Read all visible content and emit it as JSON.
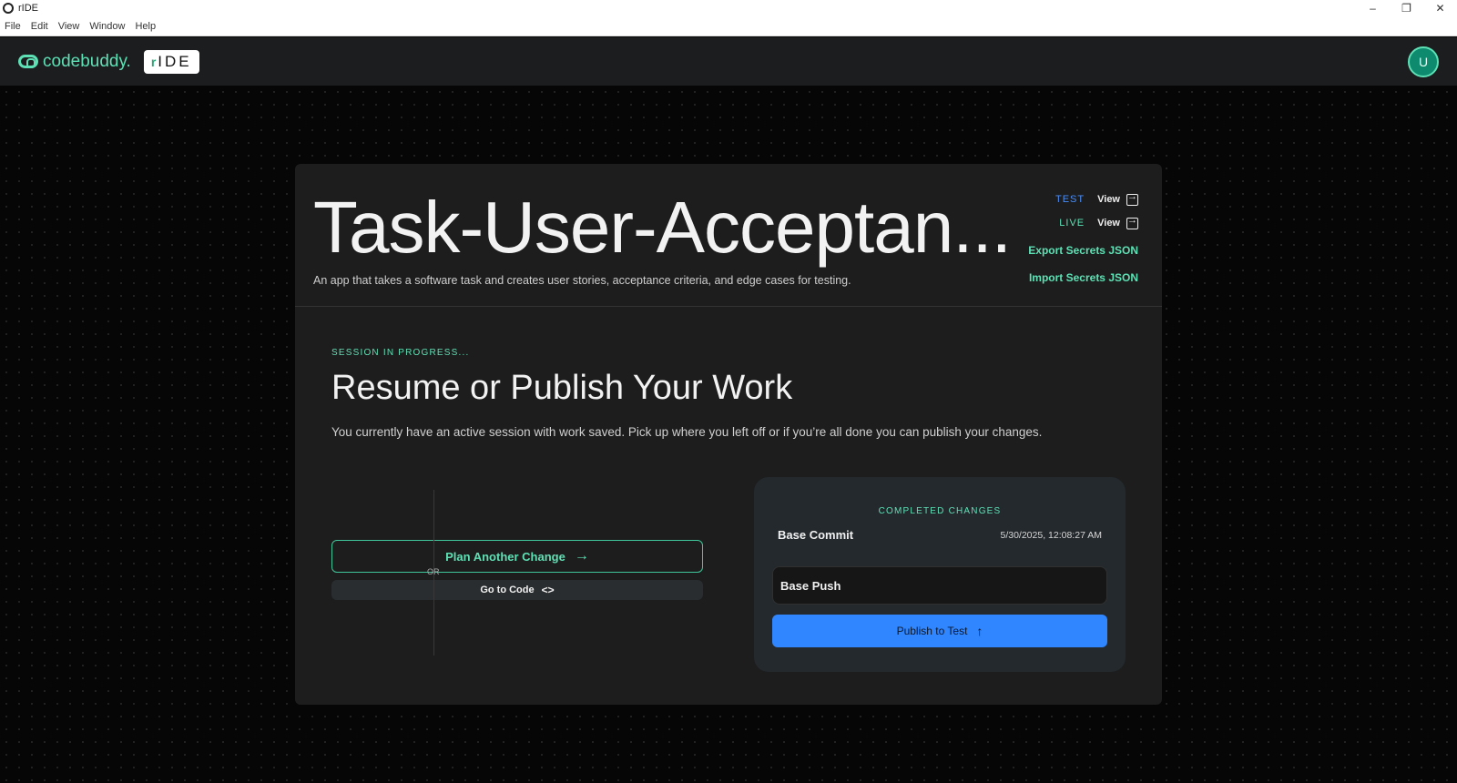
{
  "window": {
    "title": "rIDE",
    "minimize": "–",
    "restore": "❐",
    "close": "✕"
  },
  "menu": [
    "File",
    "Edit",
    "View",
    "Window",
    "Help"
  ],
  "header": {
    "brand": "codebuddy.",
    "badge_r": "r",
    "badge": "IDE",
    "avatar_initial": "U"
  },
  "app": {
    "title": "Task-User-Acceptan...",
    "description": "An app that takes a software task and creates user stories, acceptance criteria, and edge cases for testing."
  },
  "environments": [
    {
      "label": "TEST",
      "action": "View"
    },
    {
      "label": "LIVE",
      "action": "View"
    }
  ],
  "secrets": {
    "export_label": "Export Secrets JSON",
    "import_label": "Import Secrets JSON"
  },
  "session": {
    "status": "SESSION IN PROGRESS...",
    "title": "Resume or Publish Your Work",
    "description": "You currently have an active session with work saved. Pick up where you left off or if you’re all done you can publish your changes."
  },
  "actions": {
    "plan_label": "Plan Another Change",
    "plan_icon": "→",
    "code_label": "Go to Code",
    "code_icon": "<>",
    "or_label": "OR"
  },
  "changes": {
    "title": "COMPLETED CHANGES",
    "commit_name": "Base Commit",
    "commit_time": "5/30/2025, 12:08:27 AM",
    "push_name": "Base Push",
    "publish_label": "Publish to Test",
    "publish_icon": "↑"
  },
  "colors": {
    "accent_green": "#5ee0b5",
    "accent_blue": "#2f86ff",
    "card_bg": "#1d1d1d"
  }
}
